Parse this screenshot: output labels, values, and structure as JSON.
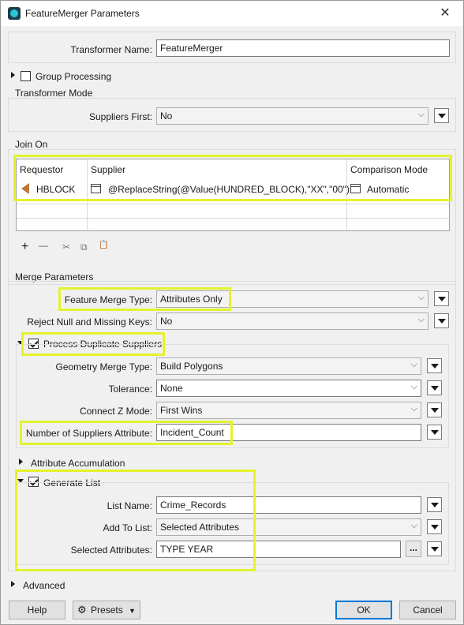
{
  "window": {
    "title": "FeatureMerger Parameters",
    "close_glyph": "✕"
  },
  "transformer_name": {
    "label": "Transformer Name:",
    "value": "FeatureMerger"
  },
  "group_processing": {
    "label": "Group Processing",
    "checked": false
  },
  "transformer_mode": {
    "title": "Transformer Mode",
    "suppliers_first_label": "Suppliers First:",
    "suppliers_first_value": "No"
  },
  "join_on": {
    "title": "Join On",
    "columns": [
      "Requestor",
      "Supplier",
      "Comparison Mode"
    ],
    "rows": [
      {
        "requestor": "HBLOCK",
        "supplier": "@ReplaceString(@Value(HUNDRED_BLOCK),\"XX\",\"00\")",
        "mode": "Automatic"
      }
    ],
    "tools": [
      "+",
      "—",
      "✂",
      "⧉",
      "📋"
    ]
  },
  "merge_parameters": {
    "title": "Merge Parameters",
    "feature_merge_type_label": "Feature Merge Type:",
    "feature_merge_type_value": "Attributes Only",
    "reject_null_label": "Reject Null and Missing Keys:",
    "reject_null_value": "No",
    "process_duplicates_label": "Process Duplicate Suppliers",
    "process_duplicates_checked": true,
    "geometry_merge_type_label": "Geometry Merge Type:",
    "geometry_merge_type_value": "Build Polygons",
    "tolerance_label": "Tolerance:",
    "tolerance_value": "None",
    "connect_z_label": "Connect Z Mode:",
    "connect_z_value": "First Wins",
    "num_suppliers_label": "Number of Suppliers Attribute:",
    "num_suppliers_value": "Incident_Count",
    "attribute_accumulation_label": "Attribute Accumulation",
    "generate_list_label": "Generate List",
    "generate_list_checked": true,
    "list_name_label": "List Name:",
    "list_name_value": "Crime_Records",
    "add_to_list_label": "Add To List:",
    "add_to_list_value": "Selected Attributes",
    "selected_attributes_label": "Selected Attributes:",
    "selected_attributes_value": "TYPE YEAR",
    "ellipsis": "..."
  },
  "advanced_label": "Advanced",
  "footer": {
    "help": "Help",
    "presets": "Presets",
    "ok": "OK",
    "cancel": "Cancel"
  },
  "colors": {
    "highlight": "#e4f22e",
    "ok_border": "#0078d7"
  }
}
